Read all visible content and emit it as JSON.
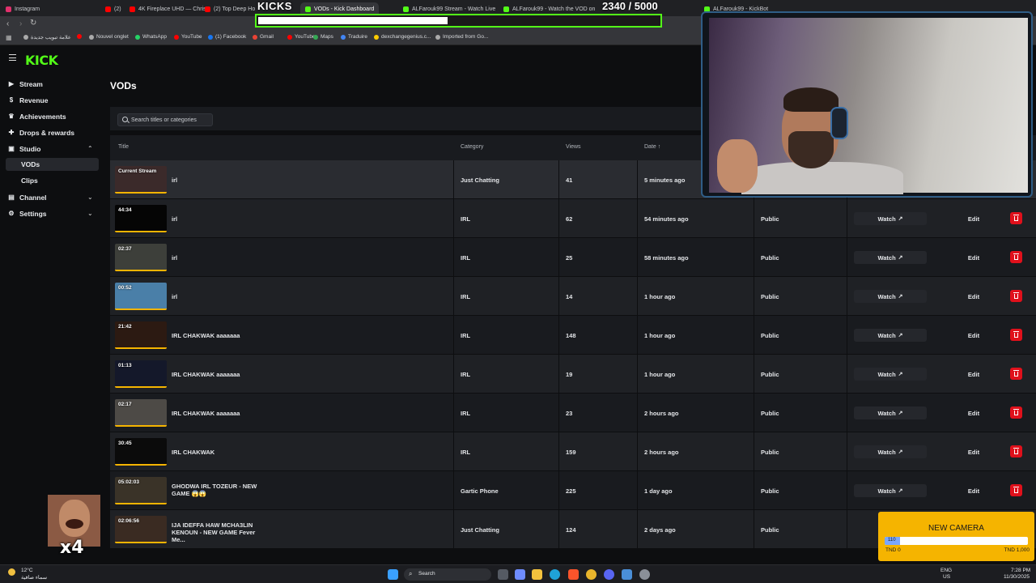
{
  "browser": {
    "tabs": [
      {
        "label": "Instagram",
        "color": "#e1306c"
      },
      {
        "label": "(2)",
        "color": "#ff0000"
      },
      {
        "label": "4K Fireplace UHD — Chris",
        "color": "#ff0000"
      },
      {
        "label": "(2) Top Deep Ho",
        "color": "#ff0000"
      },
      {
        "label": "VODs - Kick Dashboard",
        "color": "#53fc18"
      },
      {
        "label": "ALFarouk99 Stream - Watch Live on",
        "color": "#53fc18"
      },
      {
        "label": "ALFarouk99 - Watch the VOD on Kick",
        "color": "#53fc18"
      },
      {
        "label": "ALFarouk99 - KickBot",
        "color": "#53fc18"
      }
    ],
    "bookmarks": [
      {
        "label": "علامة تبويب جديدة",
        "color": "#aaaaaa"
      },
      {
        "label": "",
        "color": "#ff0000"
      },
      {
        "label": "Nouvel onglet",
        "color": "#aaaaaa"
      },
      {
        "label": "WhatsApp",
        "color": "#25d366"
      },
      {
        "label": "YouTube",
        "color": "#ff0000"
      },
      {
        "label": "(1) Facebook",
        "color": "#1877f2"
      },
      {
        "label": "Gmail",
        "color": "#ea4335"
      },
      {
        "label": "YouTube",
        "color": "#ff0000"
      },
      {
        "label": "Maps",
        "color": "#34a853"
      },
      {
        "label": "Traduire",
        "color": "#4285f4"
      },
      {
        "label": "dexchangegenius.c...",
        "color": "#ffcc00"
      },
      {
        "label": "Imported from Go...",
        "color": "#aaaaaa"
      }
    ]
  },
  "overlay": {
    "goal_title": "KICKS",
    "goal_count": "2340 / 5000",
    "goal_progress": 0.468
  },
  "sidebar": {
    "logo": "KICK",
    "items": [
      {
        "label": "Stream",
        "icon": "stream-icon"
      },
      {
        "label": "Revenue",
        "icon": "revenue-icon"
      },
      {
        "label": "Achievements",
        "icon": "trophy-icon"
      },
      {
        "label": "Drops & rewards",
        "icon": "gift-icon"
      },
      {
        "label": "Studio",
        "icon": "studio-icon"
      },
      {
        "label": "Channel",
        "icon": "channel-icon"
      },
      {
        "label": "Settings",
        "icon": "gear-icon"
      }
    ],
    "studio_sub": [
      {
        "label": "VODs",
        "selected": true
      },
      {
        "label": "Clips",
        "selected": false
      }
    ]
  },
  "main": {
    "title": "VODs",
    "search_placeholder": "Search titles or categories",
    "columns": [
      "Title",
      "Category",
      "Views",
      "Date ↑"
    ],
    "watch_label": "Watch",
    "edit_label": "Edit",
    "rows": [
      {
        "duration": "Current Stream",
        "title": "irl",
        "category": "Just Chatting",
        "views": "41",
        "date": "5 minutes ago",
        "visibility": "",
        "thumb": "#3b2a2a"
      },
      {
        "duration": "44:34",
        "title": "irl",
        "category": "IRL",
        "views": "62",
        "date": "54 minutes ago",
        "visibility": "Public",
        "thumb": "#050505"
      },
      {
        "duration": "02:37",
        "title": "irl",
        "category": "IRL",
        "views": "25",
        "date": "58 minutes ago",
        "visibility": "Public",
        "thumb": "#3d3f3a"
      },
      {
        "duration": "00:52",
        "title": "irl",
        "category": "IRL",
        "views": "14",
        "date": "1 hour ago",
        "visibility": "Public",
        "thumb": "#4a7fa8"
      },
      {
        "duration": "21:42",
        "title": "IRL CHAKWAK aaaaaaa",
        "category": "IRL",
        "views": "148",
        "date": "1 hour ago",
        "visibility": "Public",
        "thumb": "#2c1a12"
      },
      {
        "duration": "01:13",
        "title": "IRL CHAKWAK aaaaaaa",
        "category": "IRL",
        "views": "19",
        "date": "1 hour ago",
        "visibility": "Public",
        "thumb": "#14182a"
      },
      {
        "duration": "02:17",
        "title": "IRL CHAKWAK aaaaaaa",
        "category": "IRL",
        "views": "23",
        "date": "2 hours ago",
        "visibility": "Public",
        "thumb": "#4d4a46"
      },
      {
        "duration": "30:45",
        "title": "IRL CHAKWAK",
        "category": "IRL",
        "views": "159",
        "date": "2 hours ago",
        "visibility": "Public",
        "thumb": "#0b0b0b"
      },
      {
        "duration": "05:02:03",
        "title": "GHODWA IRL TOZEUR - NEW GAME 😱😱",
        "category": "Gartic Phone",
        "views": "225",
        "date": "1 day ago",
        "visibility": "Public",
        "thumb": "#3a3328"
      },
      {
        "duration": "02:06:56",
        "title": "IJA IDEFFA HAW MCHA3LIN KENOUN - NEW GAME Fever Me...",
        "category": "Just Chatting",
        "views": "124",
        "date": "2 days ago",
        "visibility": "Public",
        "thumb": "#3a2b22"
      }
    ]
  },
  "emote": {
    "multiplier": "x4"
  },
  "newcam": {
    "title": "NEW CAMERA",
    "value_label": "110",
    "progress": 0.11,
    "min": "TND 0",
    "max": "TND 1,000"
  },
  "taskbar": {
    "weather_temp": "12°C",
    "weather_desc": "سماء صافية",
    "search": "Search",
    "lang1": "ENG",
    "lang2": "US",
    "time": "7:28 PM",
    "date": "11/30/2025"
  }
}
